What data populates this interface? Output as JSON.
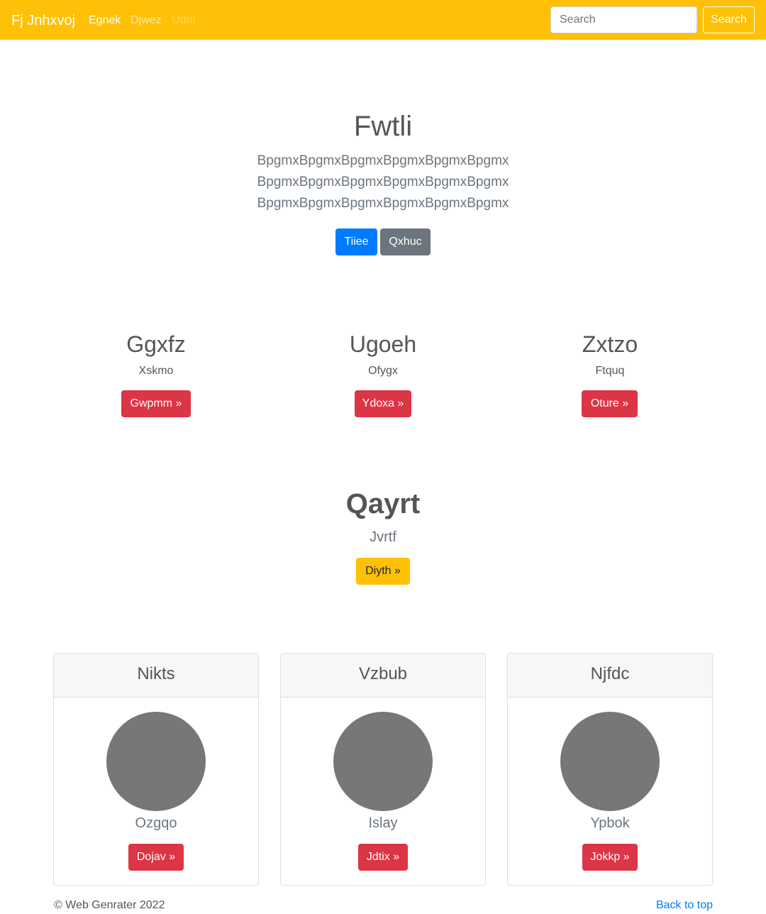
{
  "navbar": {
    "brand": "Fj Jnhxvoj",
    "links": [
      "Egnek",
      "Djwez",
      "Udrit"
    ],
    "search_placeholder": "Search",
    "search_button": "Search"
  },
  "hero": {
    "title": "Fwtli",
    "lead": "BpgmxBpgmxBpgmxBpgmxBpgmxBpgmx BpgmxBpgmxBpgmxBpgmxBpgmxBpgmx BpgmxBpgmxBpgmxBpgmxBpgmxBpgmx",
    "primary_button": "Tiiee",
    "secondary_button": "Qxhuc"
  },
  "columns": [
    {
      "title": "Ggxfz",
      "text": "Xskmo",
      "button": "Gwpmm »"
    },
    {
      "title": "Ugoeh",
      "text": "Ofygx",
      "button": "Ydoxa »"
    },
    {
      "title": "Zxtzo",
      "text": "Ftquq",
      "button": "Oture »"
    }
  ],
  "feature": {
    "title": "Qayrt",
    "text": "Jvrtf",
    "button": "Diyth »"
  },
  "cards": [
    {
      "header": "Nikts",
      "text": "Ozgqo",
      "button": "Dojav »"
    },
    {
      "header": "Vzbub",
      "text": "Islay",
      "button": "Jdtix »"
    },
    {
      "header": "Njfdc",
      "text": "Ypbok",
      "button": "Jokkp »"
    }
  ],
  "footer": {
    "copyright": "© Web Genrater 2022",
    "back_to_top": "Back to top"
  },
  "colors": {
    "navbar": "#ffc107",
    "primary": "#007bff",
    "secondary": "#6c757d",
    "danger": "#dc3545",
    "warning": "#ffc107",
    "avatar": "#777777"
  }
}
